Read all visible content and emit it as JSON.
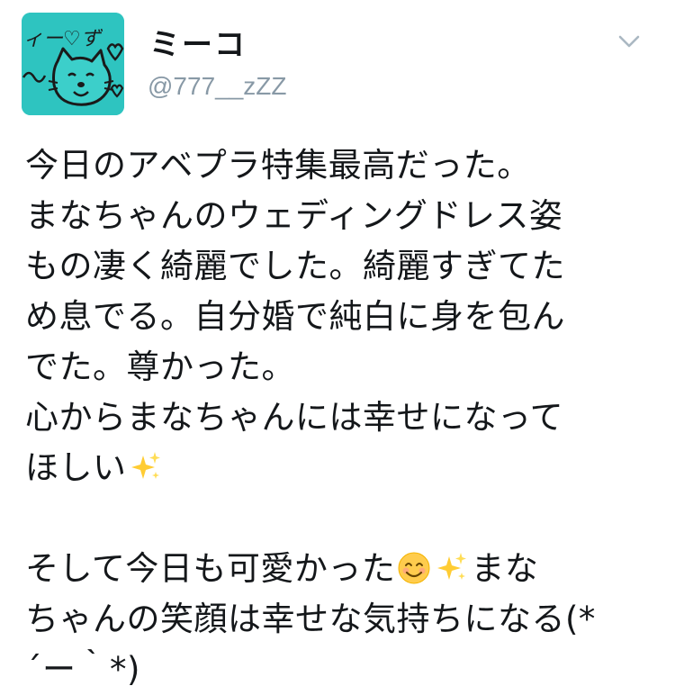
{
  "user": {
    "display_name": "ミーコ",
    "handle": "@777__zZZ",
    "avatar_text": "ィー♡ず"
  },
  "menu": {
    "icon": "chevron-down-icon"
  },
  "tweet": {
    "lines": [
      "今日のアベプラ特集最高だった。",
      "まなちゃんのウェディングドレス姿",
      "もの凄く綺麗でした。綺麗すぎてた",
      "め息でる。自分婚で純白に身を包ん",
      "でた。尊かった。",
      "心からまなちゃんには幸せになって",
      "ほしい",
      "",
      "そして今日も可愛かった",
      "まな",
      "ちゃんの笑顔は幸せな気持ちになる(*",
      "´ー｀*)"
    ]
  },
  "emojis": {
    "sparkles": "sparkles-icon",
    "smile": "smiling-face-icon"
  }
}
